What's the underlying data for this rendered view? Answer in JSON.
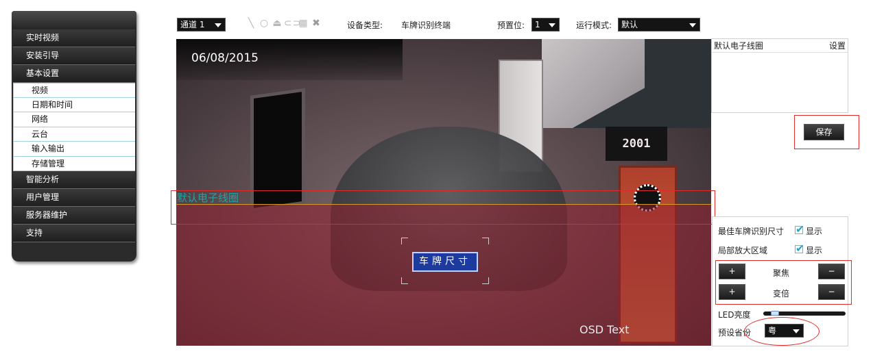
{
  "sidebar": {
    "items": [
      {
        "label": "实时视频"
      },
      {
        "label": "安装引导"
      },
      {
        "label": "基本设置"
      }
    ],
    "subitems": [
      {
        "label": "视频"
      },
      {
        "label": "日期和时间"
      },
      {
        "label": "网络"
      },
      {
        "label": "云台"
      },
      {
        "label": "输入输出"
      },
      {
        "label": "存储管理"
      }
    ],
    "items_after": [
      {
        "label": "智能分析"
      },
      {
        "label": "用户管理"
      },
      {
        "label": "服务器维护"
      },
      {
        "label": "支持"
      }
    ]
  },
  "toolbar": {
    "channel_value": "通道 1",
    "tool_icons": [
      "line-tool-icon",
      "circle-tool-icon",
      "person-tool-icon",
      "car-tool-icon",
      "grid-tool-icon",
      "delete-icon"
    ],
    "device_type_label": "设备类型:",
    "device_type_value": "车牌识别终端",
    "preset_label": "预置位:",
    "preset_value": "1",
    "run_mode_label": "运行模式:",
    "run_mode_value": "默认"
  },
  "video": {
    "date": "06/08/2015",
    "osd_text": "OSD Text",
    "zone_label": "默认电子线圈",
    "plate_box_label": "车牌尺寸",
    "sign_text": "2001"
  },
  "zone_panel": {
    "name": "默认电子线圈",
    "settings": "设置"
  },
  "save_button": "保存",
  "controls": {
    "best_plate_size_label": "最佳车牌识别尺寸",
    "best_plate_size_show": "显示",
    "best_plate_size_checked": true,
    "local_zoom_label": "局部放大区域",
    "local_zoom_show": "显示",
    "local_zoom_checked": true,
    "focus_label": "聚焦",
    "zoom_label": "变倍",
    "plus": "+",
    "minus": "−",
    "led_label": "LED亮度",
    "led_level": 0.1,
    "province_label": "预设省份",
    "province_value": "粤"
  },
  "colors": {
    "annotation_red": "#e02a2a",
    "overlay_red": "#962032",
    "zone_label_teal": "#29a0a4",
    "plate_blue": "#1d3a9e",
    "check_blue": "#1aa3d4"
  }
}
